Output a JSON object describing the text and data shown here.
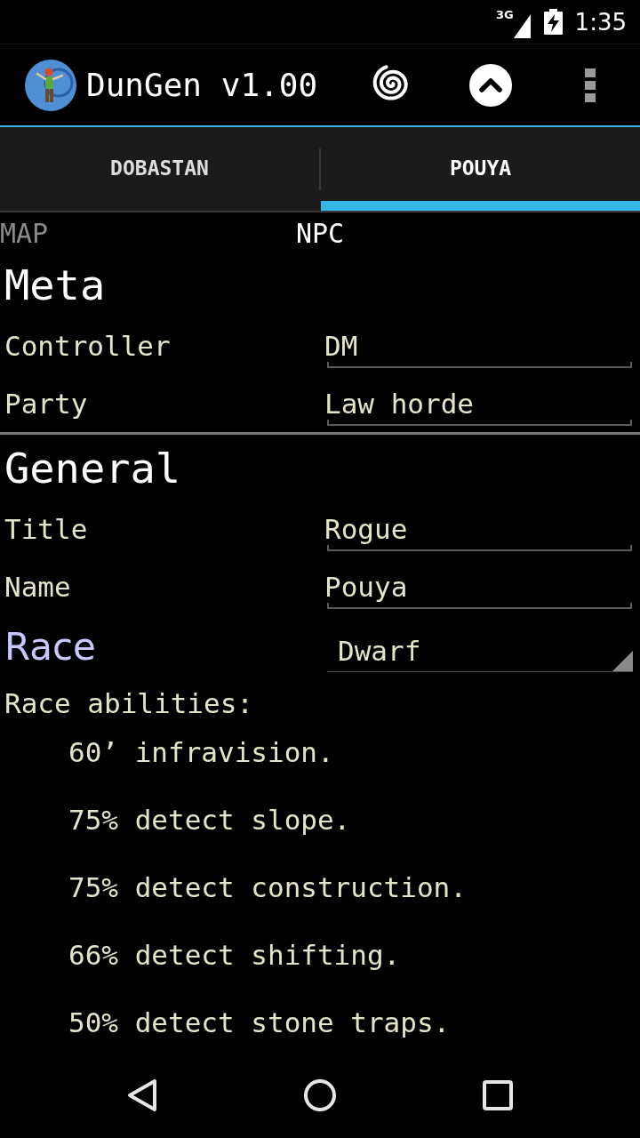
{
  "status_bar": {
    "network": "3G",
    "time": "1:35"
  },
  "action_bar": {
    "title": "DunGen v1.00"
  },
  "tabs": [
    {
      "label": "DOBASTAN",
      "selected": false
    },
    {
      "label": "POUYA",
      "selected": true
    }
  ],
  "pager_titles": [
    {
      "label": "MAP",
      "selected": false
    },
    {
      "label": "NPC",
      "selected": true
    }
  ],
  "sections": [
    {
      "heading": "Meta",
      "fields": [
        {
          "kind": "text",
          "label": "Controller",
          "value": "DM"
        },
        {
          "kind": "text",
          "label": "Party",
          "value": "Law horde"
        }
      ]
    },
    {
      "heading": "General",
      "fields": [
        {
          "kind": "text",
          "label": "Title",
          "value": "Rogue"
        },
        {
          "kind": "text",
          "label": "Name",
          "value": "Pouya"
        },
        {
          "kind": "dropdown",
          "label": "Race",
          "value": "Dwarf"
        }
      ]
    }
  ],
  "race_abilities": {
    "label": "Race abilities:",
    "items": [
      "60’ infravision.",
      "75% detect slope.",
      "75% detect construction.",
      "66% detect shifting.",
      "50% detect stone traps."
    ]
  }
}
